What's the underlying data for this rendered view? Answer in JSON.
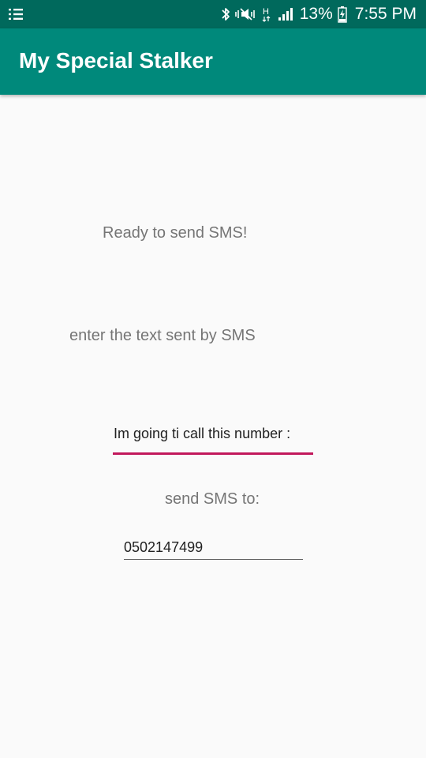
{
  "status_bar": {
    "battery_percent": "13%",
    "time": "7:55 PM",
    "icons": [
      "notification-list-icon",
      "bluetooth-icon",
      "mute-icon",
      "network-h-icon",
      "signal-icon",
      "battery-charging-icon"
    ],
    "background_color": "#00695c"
  },
  "app_bar": {
    "title": "My Special Stalker",
    "background_color": "#00897b"
  },
  "main": {
    "status_text": "Ready to send SMS!",
    "message_prompt": "enter the text sent by SMS",
    "message_value": "Im going ti call this number :",
    "recipient_prompt": "send SMS to:",
    "phone_value": "0502147499",
    "accent_color": "#c2185b"
  }
}
